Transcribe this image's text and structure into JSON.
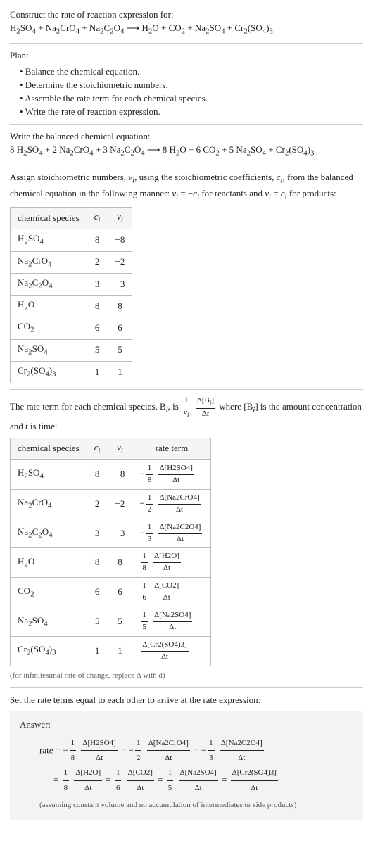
{
  "intro": {
    "construct": "Construct the rate of reaction expression for:",
    "equation_html": "H<sub>2</sub>SO<sub>4</sub> + Na<sub>2</sub>CrO<sub>4</sub> + Na<sub>2</sub>C<sub>2</sub>O<sub>4</sub> ⟶ H<sub>2</sub>O + CO<sub>2</sub> + Na<sub>2</sub>SO<sub>4</sub> + Cr<sub>2</sub>(SO<sub>4</sub>)<sub>3</sub>"
  },
  "plan": {
    "heading": "Plan:",
    "items": [
      "• Balance the chemical equation.",
      "• Determine the stoichiometric numbers.",
      "• Assemble the rate term for each chemical species.",
      "• Write the rate of reaction expression."
    ]
  },
  "balanced": {
    "heading": "Write the balanced chemical equation:",
    "equation_html": "8 H<sub>2</sub>SO<sub>4</sub> + 2 Na<sub>2</sub>CrO<sub>4</sub> + 3 Na<sub>2</sub>C<sub>2</sub>O<sub>4</sub> ⟶ 8 H<sub>2</sub>O + 6 CO<sub>2</sub> + 5 Na<sub>2</sub>SO<sub>4</sub> + Cr<sub>2</sub>(SO<sub>4</sub>)<sub>3</sub>"
  },
  "assign": {
    "text_html": "Assign stoichiometric numbers, <i>ν<sub>i</sub></i>, using the stoichiometric coefficients, <i>c<sub>i</sub></i>, from the balanced chemical equation in the following manner: <i>ν<sub>i</sub></i> = −<i>c<sub>i</sub></i> for reactants and <i>ν<sub>i</sub></i> = <i>c<sub>i</sub></i> for products:"
  },
  "table1": {
    "headers": [
      "chemical species",
      "cᵢ",
      "νᵢ"
    ],
    "rows": [
      {
        "species_html": "H<sub>2</sub>SO<sub>4</sub>",
        "c": "8",
        "v": "−8"
      },
      {
        "species_html": "Na<sub>2</sub>CrO<sub>4</sub>",
        "c": "2",
        "v": "−2"
      },
      {
        "species_html": "Na<sub>2</sub>C<sub>2</sub>O<sub>4</sub>",
        "c": "3",
        "v": "−3"
      },
      {
        "species_html": "H<sub>2</sub>O",
        "c": "8",
        "v": "8"
      },
      {
        "species_html": "CO<sub>2</sub>",
        "c": "6",
        "v": "6"
      },
      {
        "species_html": "Na<sub>2</sub>SO<sub>4</sub>",
        "c": "5",
        "v": "5"
      },
      {
        "species_html": "Cr<sub>2</sub>(SO<sub>4</sub>)<sub>3</sub>",
        "c": "1",
        "v": "1"
      }
    ]
  },
  "rateterm_intro_html": "The rate term for each chemical species, B<sub><i>i</i></sub>, is <span class='frac'><span class='num'>1</span><span class='den'><i>ν<sub>i</sub></i></span></span> <span class='frac'><span class='num'>Δ[B<sub><i>i</i></sub>]</span><span class='den'>Δ<i>t</i></span></span> where [B<sub><i>i</i></sub>] is the amount concentration and <i>t</i> is time:",
  "table2": {
    "headers": [
      "chemical species",
      "cᵢ",
      "νᵢ",
      "rate term"
    ],
    "rows": [
      {
        "species_html": "H<sub>2</sub>SO<sub>4</sub>",
        "c": "8",
        "v": "−8",
        "rate_html": "−<span class='frac'><span class='num'>1</span><span class='den'>8</span></span> <span class='frac'><span class='num'>Δ[H2SO4]</span><span class='den'>Δt</span></span>"
      },
      {
        "species_html": "Na<sub>2</sub>CrO<sub>4</sub>",
        "c": "2",
        "v": "−2",
        "rate_html": "−<span class='frac'><span class='num'>1</span><span class='den'>2</span></span> <span class='frac'><span class='num'>Δ[Na2CrO4]</span><span class='den'>Δt</span></span>"
      },
      {
        "species_html": "Na<sub>2</sub>C<sub>2</sub>O<sub>4</sub>",
        "c": "3",
        "v": "−3",
        "rate_html": "−<span class='frac'><span class='num'>1</span><span class='den'>3</span></span> <span class='frac'><span class='num'>Δ[Na2C2O4]</span><span class='den'>Δt</span></span>"
      },
      {
        "species_html": "H<sub>2</sub>O",
        "c": "8",
        "v": "8",
        "rate_html": "<span class='frac'><span class='num'>1</span><span class='den'>8</span></span> <span class='frac'><span class='num'>Δ[H2O]</span><span class='den'>Δt</span></span>"
      },
      {
        "species_html": "CO<sub>2</sub>",
        "c": "6",
        "v": "6",
        "rate_html": "<span class='frac'><span class='num'>1</span><span class='den'>6</span></span> <span class='frac'><span class='num'>Δ[CO2]</span><span class='den'>Δt</span></span>"
      },
      {
        "species_html": "Na<sub>2</sub>SO<sub>4</sub>",
        "c": "5",
        "v": "5",
        "rate_html": "<span class='frac'><span class='num'>1</span><span class='den'>5</span></span> <span class='frac'><span class='num'>Δ[Na2SO4]</span><span class='den'>Δt</span></span>"
      },
      {
        "species_html": "Cr<sub>2</sub>(SO<sub>4</sub>)<sub>3</sub>",
        "c": "1",
        "v": "1",
        "rate_html": "<span class='frac'><span class='num'>Δ[Cr2(SO4)3]</span><span class='den'>Δt</span></span>"
      }
    ]
  },
  "note_infinitesimal": "(for infinitesimal rate of change, replace Δ with d)",
  "set_equal": "Set the rate terms equal to each other to arrive at the rate expression:",
  "answer": {
    "label": "Answer:",
    "line1_html": "rate = −<span class='frac'><span class='num'>1</span><span class='den'>8</span></span> <span class='frac'><span class='num'>Δ[H2SO4]</span><span class='den'>Δt</span></span> = −<span class='frac'><span class='num'>1</span><span class='den'>2</span></span> <span class='frac'><span class='num'>Δ[Na2CrO4]</span><span class='den'>Δt</span></span> = −<span class='frac'><span class='num'>1</span><span class='den'>3</span></span> <span class='frac'><span class='num'>Δ[Na2C2O4]</span><span class='den'>Δt</span></span>",
    "line2_html": "= <span class='frac'><span class='num'>1</span><span class='den'>8</span></span> <span class='frac'><span class='num'>Δ[H2O]</span><span class='den'>Δt</span></span> = <span class='frac'><span class='num'>1</span><span class='den'>6</span></span> <span class='frac'><span class='num'>Δ[CO2]</span><span class='den'>Δt</span></span> = <span class='frac'><span class='num'>1</span><span class='den'>5</span></span> <span class='frac'><span class='num'>Δ[Na2SO4]</span><span class='den'>Δt</span></span> = <span class='frac'><span class='num'>Δ[Cr2(SO4)3]</span><span class='den'>Δt</span></span>",
    "assume": "(assuming constant volume and no accumulation of intermediates or side products)"
  }
}
